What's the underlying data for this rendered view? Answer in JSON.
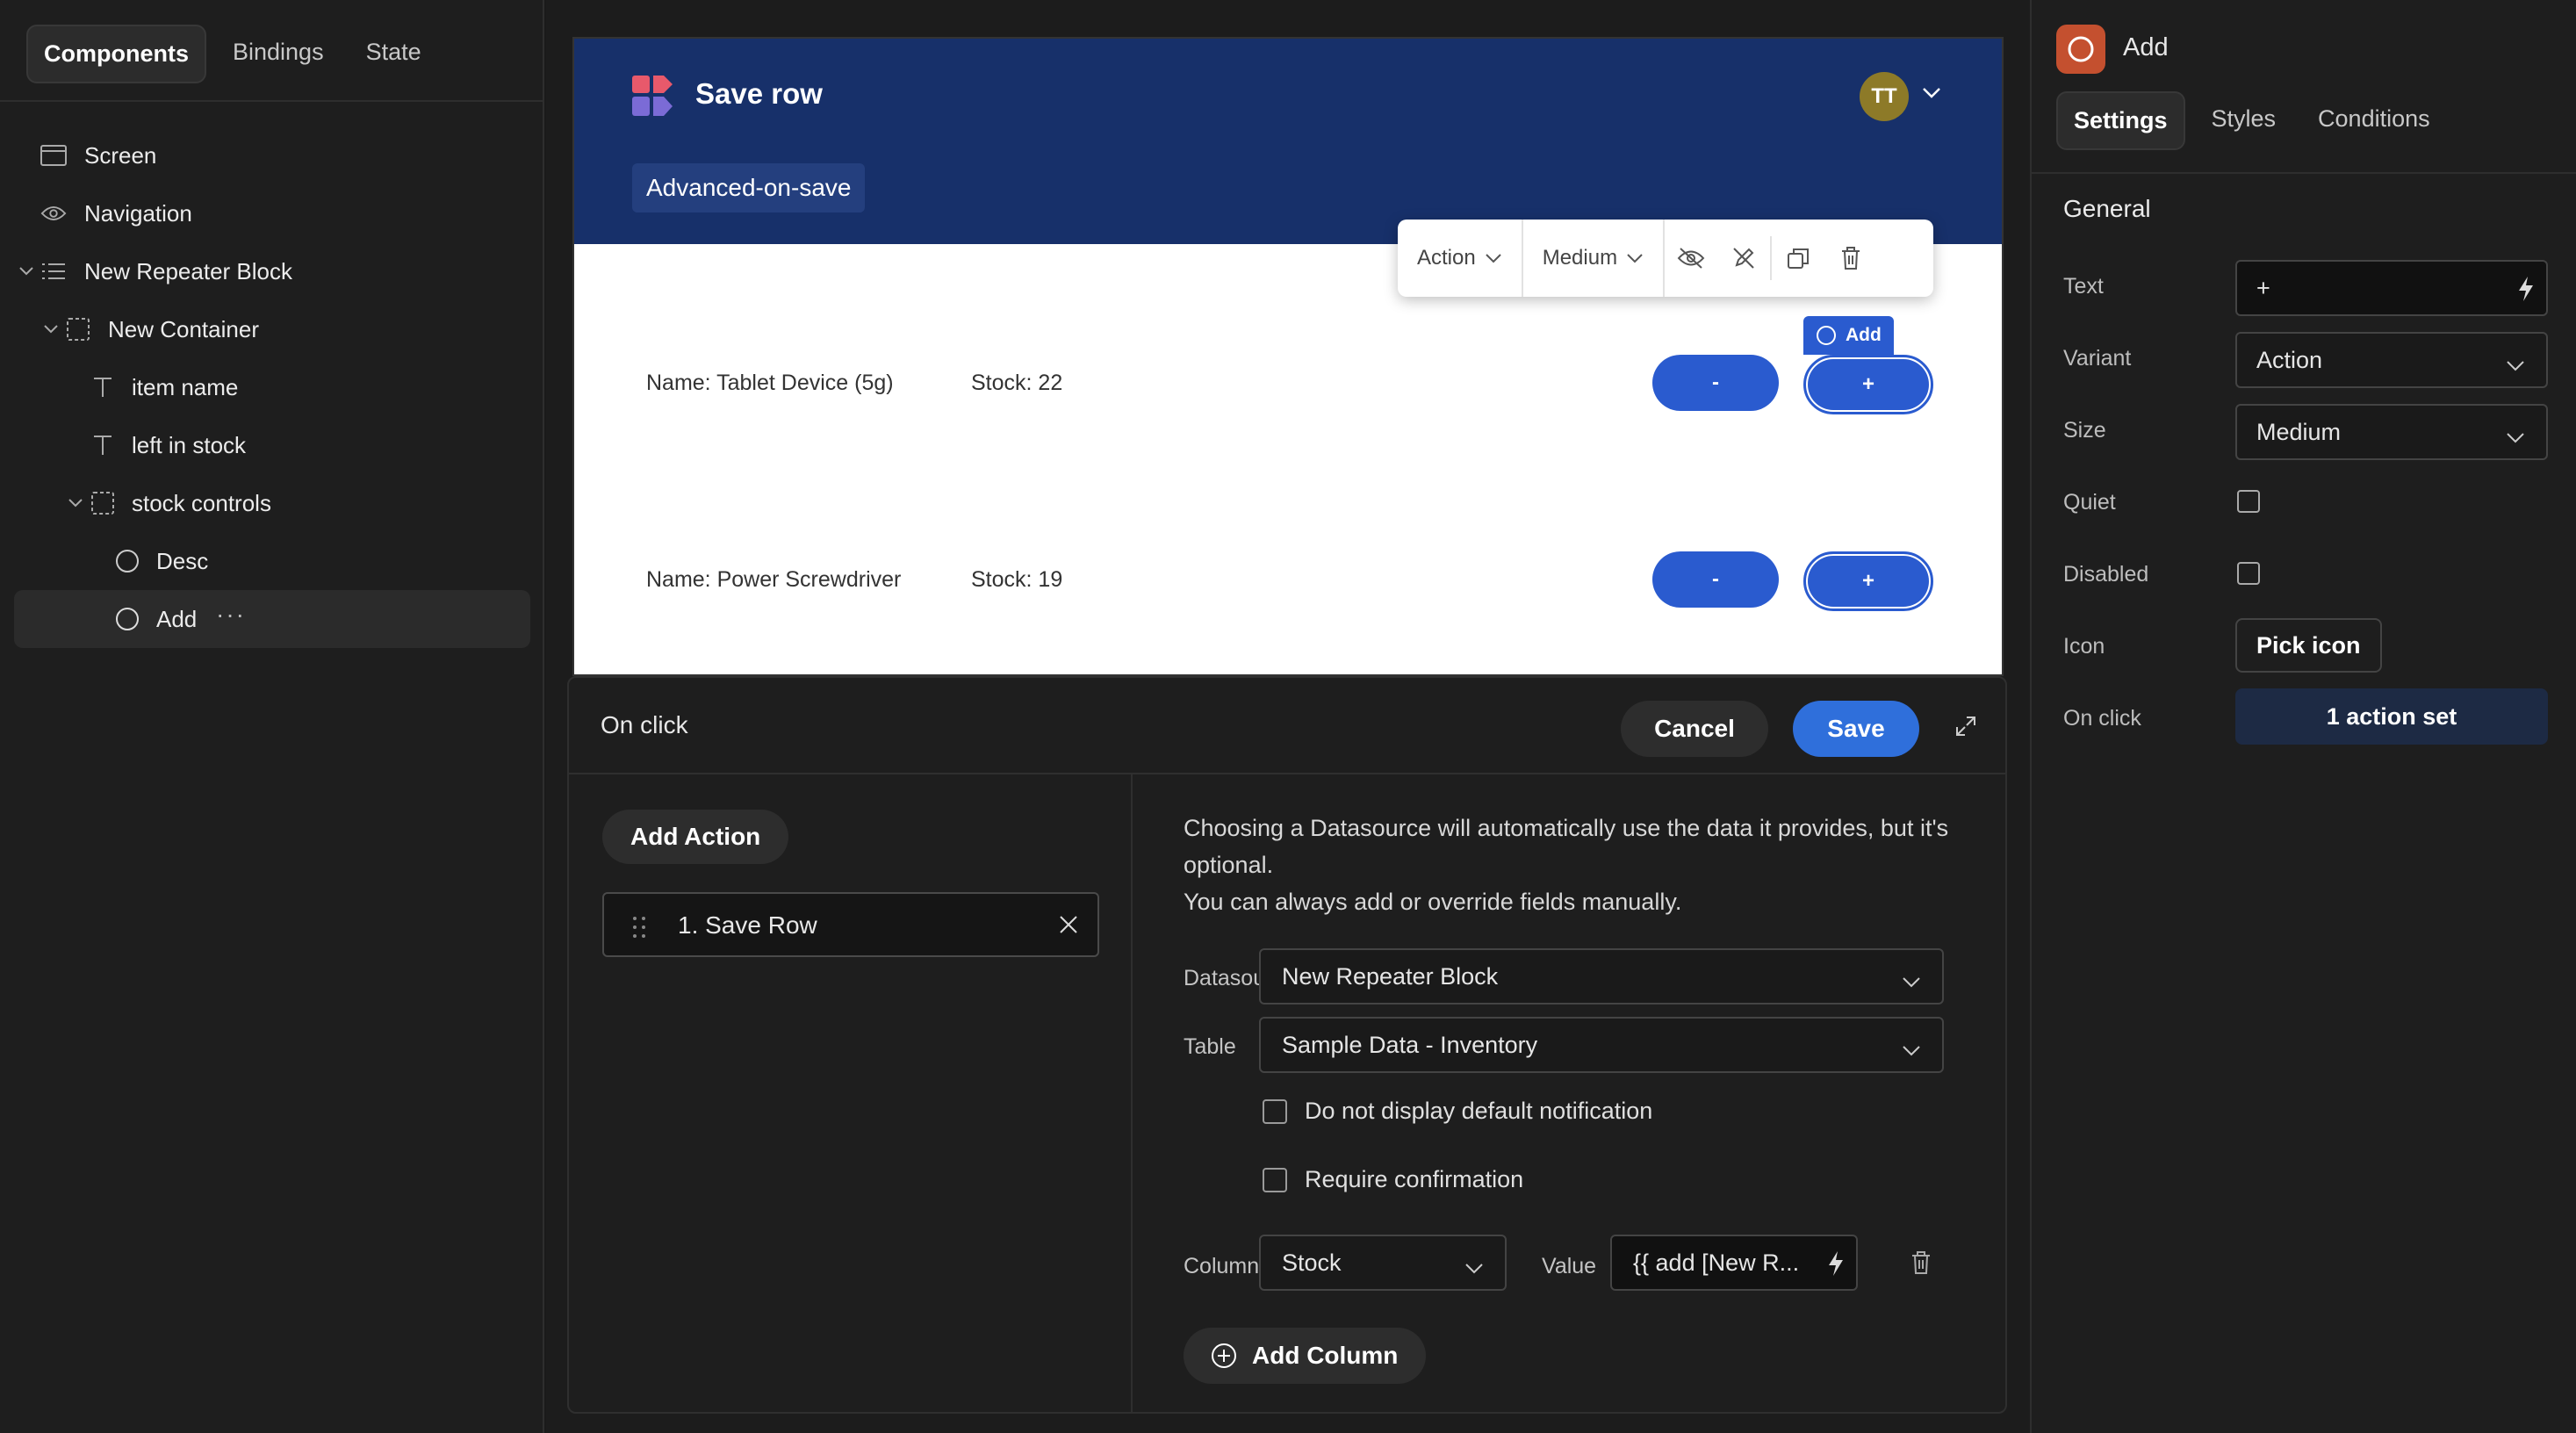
{
  "left_panel": {
    "tabs": [
      "Components",
      "Bindings",
      "State"
    ],
    "tree": [
      {
        "label": "Screen",
        "icon": "screen-icon"
      },
      {
        "label": "Navigation",
        "icon": "eye-icon"
      },
      {
        "label": "New Repeater Block",
        "icon": "list-icon"
      },
      {
        "label": "New Container",
        "icon": "container-icon"
      },
      {
        "label": "item name",
        "icon": "text-icon"
      },
      {
        "label": "left in stock",
        "icon": "text-icon"
      },
      {
        "label": "stock controls",
        "icon": "container-icon"
      },
      {
        "label": "Desc",
        "icon": "button-icon"
      },
      {
        "label": "Add",
        "icon": "button-icon"
      }
    ],
    "more": "···"
  },
  "preview": {
    "app_title": "Save row",
    "avatar": "TT",
    "nav_item": "Advanced-on-save",
    "toolbar": {
      "variant": "Action",
      "size": "Medium"
    },
    "add_tag": "Add",
    "rows": [
      {
        "name": "Name: Tablet Device (5g)",
        "stock": "Stock: 22"
      },
      {
        "name": "Name: Power Screwdriver",
        "stock": "Stock: 19"
      }
    ],
    "minus_label": "-",
    "plus_label": "+"
  },
  "drawer": {
    "title": "On click",
    "cancel": "Cancel",
    "save": "Save",
    "add_action": "Add Action",
    "action_item": "1. Save Row",
    "help_line1": "Choosing a Datasource will automatically use the data it provides, but it's optional.",
    "help_line2": "You can always add or override fields manually.",
    "datasource_label": "Datasource",
    "datasource_value": "New Repeater Block",
    "table_label": "Table",
    "table_value": "Sample Data - Inventory",
    "check1": "Do not display default notification",
    "check2": "Require confirmation",
    "column_label": "Column",
    "column_value": "Stock",
    "value_label": "Value",
    "value_value": "{{ add [New R...",
    "add_column": "Add Column"
  },
  "right_panel": {
    "component": "Add",
    "tabs": [
      "Settings",
      "Styles",
      "Conditions"
    ],
    "section": "General",
    "text_label": "Text",
    "text_value": "+",
    "variant_label": "Variant",
    "variant_value": "Action",
    "size_label": "Size",
    "size_value": "Medium",
    "quiet_label": "Quiet",
    "disabled_label": "Disabled",
    "icon_label": "Icon",
    "icon_button": "Pick icon",
    "onclick_label": "On click",
    "onclick_value": "1 action set"
  },
  "colors": {
    "header_blue": "#17306a",
    "primary_button": "#2a5bcf",
    "save_blue": "#2f6fdb",
    "component_icon": "#c4502f",
    "avatar": "#8d7a28"
  }
}
